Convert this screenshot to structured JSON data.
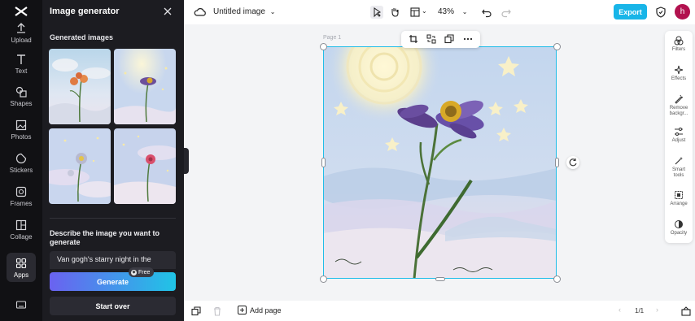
{
  "rail": {
    "items": [
      {
        "label": "Upload",
        "icon": "upload-icon"
      },
      {
        "label": "Text",
        "icon": "text-icon"
      },
      {
        "label": "Shapes",
        "icon": "shapes-icon"
      },
      {
        "label": "Photos",
        "icon": "photos-icon"
      },
      {
        "label": "Stickers",
        "icon": "stickers-icon"
      },
      {
        "label": "Frames",
        "icon": "frames-icon"
      },
      {
        "label": "Collage",
        "icon": "collage-icon"
      },
      {
        "label": "Apps",
        "icon": "apps-icon"
      }
    ]
  },
  "panel": {
    "title": "Image generator",
    "section_title": "Generated images",
    "describe_label": "Describe the image you want to generate",
    "prompt_value": "Van gogh's starry night in the",
    "generate_label": "Generate",
    "free_badge": "Free",
    "start_over_label": "Start over"
  },
  "topbar": {
    "doc_title": "Untitled image",
    "zoom": "43%",
    "export_label": "Export",
    "avatar_initial": "h"
  },
  "canvas": {
    "page_label": "Page 1"
  },
  "right_tools": [
    {
      "label": "Filters",
      "icon": "filters-icon"
    },
    {
      "label": "Effects",
      "icon": "effects-icon"
    },
    {
      "label": "Remove backgr...",
      "icon": "remove-background-icon"
    },
    {
      "label": "Adjust",
      "icon": "adjust-icon"
    },
    {
      "label": "Smart tools",
      "icon": "smart-tools-icon"
    },
    {
      "label": "Arrange",
      "icon": "arrange-icon"
    },
    {
      "label": "Opacity",
      "icon": "opacity-icon"
    }
  ],
  "bottombar": {
    "add_page_label": "Add page",
    "page_count": "1/1"
  },
  "colors": {
    "accent": "#18b5e8",
    "selection": "#20bde8",
    "rail_bg": "#111114",
    "panel_bg": "#1c1c21",
    "avatar": "#b2124f"
  }
}
